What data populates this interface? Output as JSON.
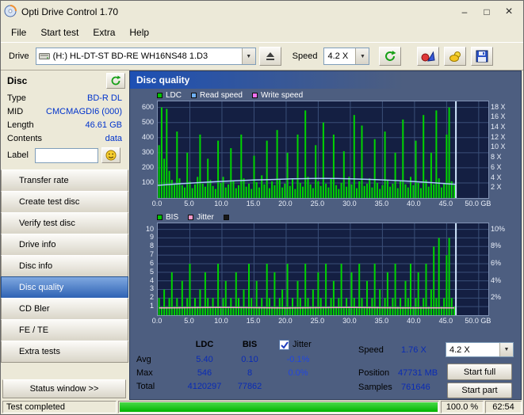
{
  "window": {
    "title": "Opti Drive Control 1.70",
    "minimize": "–",
    "maximize": "□",
    "close": "×"
  },
  "icons": {
    "dropdown": "▼"
  },
  "menu": {
    "items": [
      "File",
      "Start test",
      "Extra",
      "Help"
    ]
  },
  "toolbar": {
    "drive_label": "Drive",
    "drive_value": "(H:)   HL-DT-ST BD-RE  WH16NS48 1.D3",
    "speed_label": "Speed",
    "speed_value": "4.2 X"
  },
  "sidebar": {
    "disc_header": "Disc",
    "info": [
      {
        "label": "Type",
        "value": "BD-R DL"
      },
      {
        "label": "MID",
        "value": "CMCMAGDI6 (000)"
      },
      {
        "label": "Length",
        "value": "46.61 GB"
      },
      {
        "label": "Contents",
        "value": "data"
      }
    ],
    "label_field": {
      "label": "Label",
      "value": ""
    },
    "buttons": [
      {
        "label": "Transfer rate",
        "active": false
      },
      {
        "label": "Create test disc",
        "active": false
      },
      {
        "label": "Verify test disc",
        "active": false
      },
      {
        "label": "Drive info",
        "active": false
      },
      {
        "label": "Disc info",
        "active": false
      },
      {
        "label": "Disc quality",
        "active": true
      },
      {
        "label": "CD Bler",
        "active": false
      },
      {
        "label": "FE / TE",
        "active": false
      },
      {
        "label": "Extra tests",
        "active": false
      }
    ],
    "status_button": "Status window >>"
  },
  "panel": {
    "title": "Disc quality"
  },
  "chart_data": [
    {
      "type": "bar",
      "title": "LDC vs position with read speed overlay",
      "legend": [
        "LDC",
        "Read speed",
        "Write speed"
      ],
      "legend_colors": [
        "#00c400",
        "#6fb0f8",
        "#f070f0"
      ],
      "xlabel": "GB",
      "xlim": [
        0,
        51.5
      ],
      "x_ticks": [
        0,
        5,
        10,
        15,
        20,
        25,
        30,
        35,
        40,
        45,
        50
      ],
      "x_tick_labels": [
        "0.0",
        "5.0",
        "10.0",
        "15.0",
        "20.0",
        "25.0",
        "30.0",
        "35.0",
        "40.0",
        "45.0",
        "50.0 GB"
      ],
      "ylim_left": [
        0,
        640
      ],
      "y_ticks_left": [
        100,
        200,
        300,
        400,
        500,
        600
      ],
      "y_left_labels": [
        "100",
        "200",
        "300",
        "400",
        "500",
        "600"
      ],
      "grid_ticks": [
        100,
        200,
        300,
        400,
        500,
        600
      ],
      "ylim_right": [
        0,
        19.2
      ],
      "y_ticks_right": [
        2,
        4,
        6,
        8,
        10,
        12,
        14,
        16,
        18
      ],
      "y_right_labels": [
        "2 X",
        "4 X",
        "6 X",
        "8 X",
        "10 X",
        "12 X",
        "14 X",
        "16 X",
        "18 X"
      ],
      "bars": {
        "name": "LDC",
        "color": "#00d400",
        "x_start": 0.2,
        "x_step": 0.4,
        "values": [
          350,
          600,
          260,
          590,
          180,
          120,
          90,
          440,
          130,
          85,
          70,
          300,
          110,
          65,
          90,
          140,
          420,
          95,
          75,
          260,
          120,
          80,
          60,
          380,
          100,
          140,
          70,
          90,
          330,
          110,
          65,
          85,
          420,
          130,
          75,
          95,
          60,
          280,
          105,
          70,
          150,
          90,
          380,
          65,
          110,
          85,
          450,
          120,
          70,
          95,
          300,
          80,
          130,
          60,
          420,
          100,
          75,
          580,
          140,
          90,
          65,
          350,
          110,
          80,
          500,
          95,
          70,
          130,
          420,
          85,
          60,
          100,
          310,
          75,
          140,
          90,
          550,
          65,
          110,
          480,
          80,
          95,
          130,
          70,
          390,
          100,
          60,
          85,
          440,
          120,
          75,
          95,
          300,
          65,
          110,
          520,
          90,
          70,
          140,
          85,
          380,
          100,
          65,
          550,
          120,
          75,
          300,
          90,
          580,
          130,
          70,
          95,
          420,
          600,
          110,
          85
        ]
      },
      "line": {
        "name": "Read speed",
        "color": "#a8ccf8",
        "points": [
          [
            0,
            84
          ],
          [
            3,
            93
          ],
          [
            6,
            101
          ],
          [
            9,
            108
          ],
          [
            12,
            114
          ],
          [
            15,
            119
          ],
          [
            18,
            123
          ],
          [
            21,
            127
          ],
          [
            24,
            129
          ],
          [
            26,
            130
          ],
          [
            28,
            129
          ],
          [
            31,
            126
          ],
          [
            34,
            122
          ],
          [
            37,
            116
          ],
          [
            40,
            109
          ],
          [
            43,
            101
          ],
          [
            45.5,
            93
          ],
          [
            46.4,
            90
          ]
        ]
      },
      "cursor_x": 46.45
    },
    {
      "type": "bar",
      "title": "BIS vs position with jitter overlay",
      "legend": [
        "BIS",
        "Jitter",
        ""
      ],
      "legend_colors": [
        "#00c400",
        "#f898c8",
        "#181818"
      ],
      "xlabel": "GB",
      "xlim": [
        0,
        51.5
      ],
      "x_ticks": [
        0,
        5,
        10,
        15,
        20,
        25,
        30,
        35,
        40,
        45,
        50
      ],
      "x_tick_labels": [
        "0.0",
        "5.0",
        "10.0",
        "15.0",
        "20.0",
        "25.0",
        "30.0",
        "35.0",
        "40.0",
        "45.0",
        "50.0 GB"
      ],
      "ylim_left": [
        0,
        10.7
      ],
      "y_ticks_left": [
        1,
        2,
        3,
        4,
        5,
        6,
        7,
        8,
        9,
        10
      ],
      "y_left_labels": [
        "1",
        "2",
        "3",
        "4",
        "5",
        "6",
        "7",
        "8",
        "9",
        "10"
      ],
      "grid_ticks": [
        1,
        2,
        3,
        4,
        5,
        6,
        7,
        8,
        9,
        10
      ],
      "ylim_right": [
        0,
        10.7
      ],
      "y_ticks_right": [
        2,
        4,
        6,
        8,
        10
      ],
      "y_right_labels": [
        "2%",
        "4%",
        "6%",
        "8%",
        "10%"
      ],
      "bars": {
        "name": "BIS",
        "color": "#00d400",
        "x_start": 0.2,
        "x_step": 0.4,
        "values": [
          2,
          1,
          3,
          1,
          2,
          5,
          1,
          2,
          1,
          4,
          1,
          2,
          6,
          1,
          2,
          1,
          3,
          1,
          5,
          2,
          1,
          2,
          1,
          6,
          1,
          2,
          4,
          1,
          2,
          1,
          5,
          2,
          1,
          3,
          1,
          6,
          2,
          1,
          4,
          1,
          2,
          1,
          6,
          2,
          1,
          5,
          1,
          2,
          3,
          1,
          6,
          1,
          2,
          1,
          4,
          2,
          1,
          6,
          2,
          1,
          3,
          1,
          5,
          2,
          1,
          6,
          1,
          2,
          4,
          1,
          2,
          6,
          1,
          2,
          1,
          5,
          2,
          1,
          6,
          2,
          1,
          4,
          1,
          2,
          6,
          1,
          3,
          1,
          2,
          5,
          1,
          2,
          6,
          1,
          2,
          1,
          4,
          2,
          6,
          1,
          2,
          5,
          1,
          2,
          6,
          1,
          3,
          8,
          2,
          9,
          1,
          2,
          7,
          9,
          2,
          1
        ]
      },
      "line": {
        "name": "Jitter",
        "color": "#f8a8d0",
        "points": [
          [
            0.2,
            0.85
          ],
          [
            10,
            0.9
          ],
          [
            20,
            0.85
          ],
          [
            30,
            0.9
          ],
          [
            40,
            0.85
          ],
          [
            46.2,
            0.85
          ]
        ]
      },
      "cursor_x": 46.45
    }
  ],
  "stats": {
    "col_ldc": "LDC",
    "col_bis": "BIS",
    "jitter_label": "Jitter",
    "jitter_checked": true,
    "avg_label": "Avg",
    "avg_ldc": "5.40",
    "avg_bis": "0.10",
    "avg_jitter": "-0.1%",
    "max_label": "Max",
    "max_ldc": "546",
    "max_bis": "8",
    "max_jitter": "0.0%",
    "total_label": "Total",
    "total_ldc": "4120297",
    "total_bis": "77862",
    "speed_label": "Speed",
    "speed_value": "1.76 X",
    "speed_select": "4.2 X",
    "position_label": "Position",
    "position_value": "47731 MB",
    "samples_label": "Samples",
    "samples_value": "761646",
    "start_full": "Start full",
    "start_part": "Start part"
  },
  "statusbar": {
    "text": "Test completed",
    "progress_pct": 100,
    "percent_label": "100.0 %",
    "time": "62:54"
  }
}
